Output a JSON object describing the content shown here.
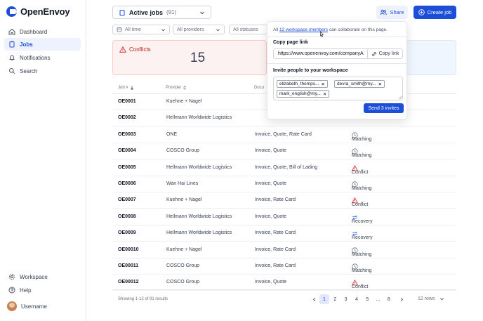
{
  "app": {
    "name": "OpenEnvoy"
  },
  "sidebar": {
    "items": [
      {
        "label": "Dashboard",
        "icon": "home-icon"
      },
      {
        "label": "Jobs",
        "icon": "clipboard-icon",
        "active": true
      },
      {
        "label": "Notifications",
        "icon": "bell-icon"
      },
      {
        "label": "Search",
        "icon": "search-icon"
      }
    ],
    "bottom": [
      {
        "label": "Workspace",
        "icon": "gear-icon"
      },
      {
        "label": "Help",
        "icon": "help-icon"
      }
    ],
    "user": "Username"
  },
  "header": {
    "view_title": "Active jobs",
    "view_count": "(91)",
    "share_label": "Share",
    "create_label": "Create job"
  },
  "filters": {
    "time": "All time",
    "providers": "All providers",
    "statuses": "All statuses"
  },
  "summary": {
    "conflicts_label": "Conflicts",
    "conflicts_count": "15"
  },
  "table": {
    "columns": {
      "job": "Job #",
      "provider": "Provider",
      "documents": "Docu"
    },
    "rows": [
      {
        "id": "OE0001",
        "provider": "Kuehne + Nagel",
        "docs": "",
        "status": ""
      },
      {
        "id": "OE0002",
        "provider": "Hellmann Worldwide Logistics",
        "docs": "",
        "status": ""
      },
      {
        "id": "OE0003",
        "provider": "ONE",
        "docs": "Invoice, Quote, Rate Card",
        "status": "Matching"
      },
      {
        "id": "OE0004",
        "provider": "COSCO Group",
        "docs": "Invoice, Quote",
        "status": "Matching"
      },
      {
        "id": "OE0005",
        "provider": "Hellmann Worldwide Logistics",
        "docs": "Invoice, Quote, Bill of Lading",
        "status": "Conflict"
      },
      {
        "id": "OE0006",
        "provider": "Wan Hai Lines",
        "docs": "Invoice, Quote",
        "status": "Matching"
      },
      {
        "id": "OE0007",
        "provider": "Kuehne + Nagel",
        "docs": "Invoice, Rate Card",
        "status": "Conflict"
      },
      {
        "id": "OE0008",
        "provider": "Hellmann Worldwide Logistics",
        "docs": "Invoice, Quote",
        "status": "Recovery"
      },
      {
        "id": "OE0009",
        "provider": "Hellmann Worldwide Logistics",
        "docs": "Invoice, Rate Card",
        "status": "Recovery"
      },
      {
        "id": "OE00010",
        "provider": "Kuehne + Nagel",
        "docs": "Invoice, Rate Card",
        "status": "Matching"
      },
      {
        "id": "OE00011",
        "provider": "COSCO Group",
        "docs": "Invoice, Rate Card",
        "status": "Matching"
      },
      {
        "id": "OE00012",
        "provider": "COSCO Group",
        "docs": "Invoice, Quote",
        "status": "Conflict"
      }
    ]
  },
  "footer": {
    "showing": "Showing 1-12 of 91 results",
    "pages": [
      "1",
      "2",
      "3",
      "4",
      "5",
      "...",
      "8"
    ],
    "current_page": "1",
    "rows_label": "12 rows"
  },
  "share_popover": {
    "intro_before": "All ",
    "intro_link": "12 workspace members",
    "intro_after": " can collaborate on this page.",
    "copy_heading": "Copy page link",
    "page_url": "https://www.openenvoy.com/companyA",
    "copy_label": "Copy link",
    "invite_heading": "Invite people to your workspace",
    "invitees": [
      "elizabeth_thomps...",
      "devra_smith@my...",
      "mark_english@my..."
    ],
    "send_label": "Send 3 invites"
  },
  "colors": {
    "accent": "#1d4ed8",
    "conflict": "#dc2626",
    "matching": "#6b7280",
    "recovery": "#2563eb"
  }
}
